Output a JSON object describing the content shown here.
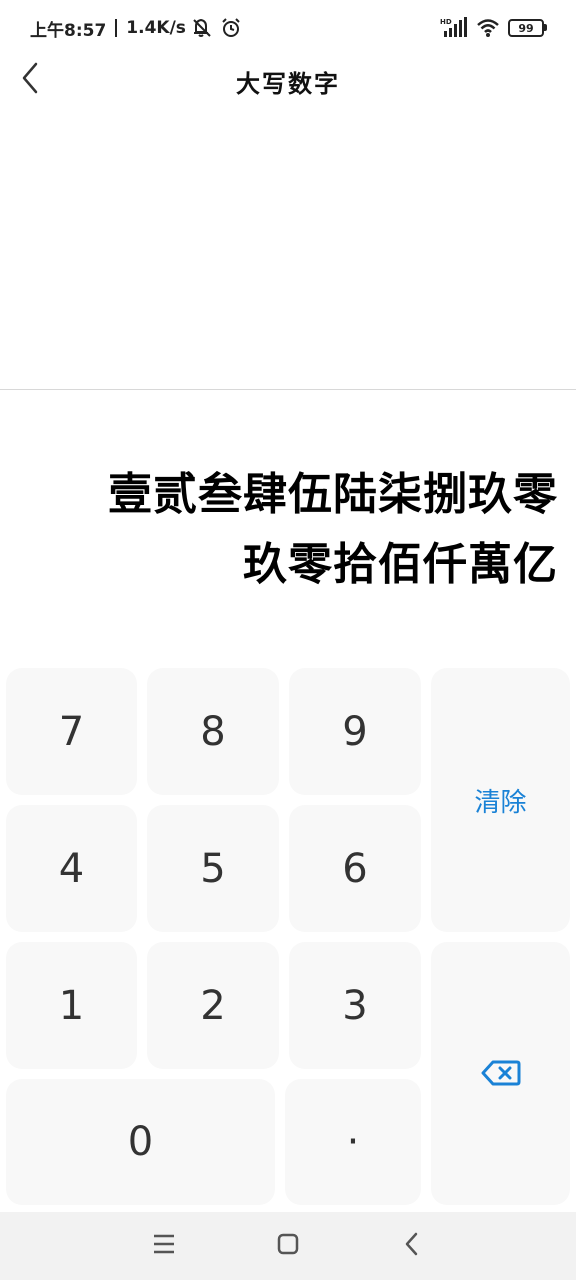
{
  "status_bar": {
    "time": "上午8:57",
    "net_speed": "1.4K/s",
    "battery": "99",
    "icons": [
      "mute-icon",
      "alarm-icon",
      "hd-signal-icon",
      "wifi-icon",
      "battery-icon"
    ]
  },
  "header": {
    "title": "大写数字",
    "back_icon": "chevron-left-icon"
  },
  "result": {
    "line1": "壹贰叁肆伍陆柒捌玖零",
    "line2": "玖零拾佰仟萬亿"
  },
  "keypad": {
    "k7": "7",
    "k8": "8",
    "k9": "9",
    "k4": "4",
    "k5": "5",
    "k6": "6",
    "k1": "1",
    "k2": "2",
    "k3": "3",
    "k0": "0",
    "dot": "·",
    "clear": "清除",
    "backspace_icon": "backspace-icon"
  },
  "nav_bar": {
    "icons": [
      "menu-icon",
      "home-icon",
      "back-icon"
    ]
  },
  "colors": {
    "accent": "#1a82d6",
    "key_bg": "#f8f8f8",
    "navbar_bg": "#f2f2f2"
  }
}
